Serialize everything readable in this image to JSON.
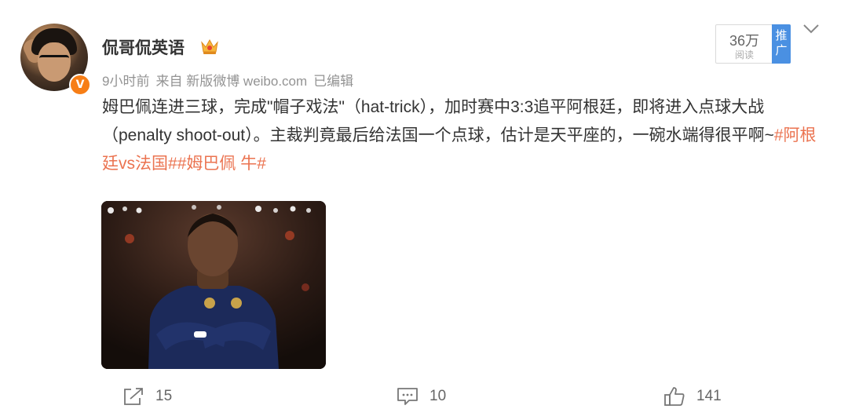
{
  "user": {
    "name": "侃哥侃英语",
    "verified_badge": "V",
    "badge_color": "#f77e16"
  },
  "meta": {
    "time": "9小时前",
    "source": "来自 新版微博 weibo.com",
    "edited": "已编辑"
  },
  "reads": {
    "count": "36万",
    "label": "阅读",
    "promote": "推广"
  },
  "post": {
    "text": "姆巴佩连进三球，完成\"帽子戏法\"（hat-trick），加时赛中3:3追平阿根廷，即将进入点球大战（penalty shoot-out）。主裁判竟最后给法国一个点球，估计是天平座的，一碗水端得很平啊~",
    "tags": [
      "#阿根廷vs法国#",
      "#姆巴佩 牛#"
    ],
    "tag_color": "#eb7350"
  },
  "actions": {
    "forward_count": "15",
    "comment_count": "10",
    "like_count": "141"
  }
}
